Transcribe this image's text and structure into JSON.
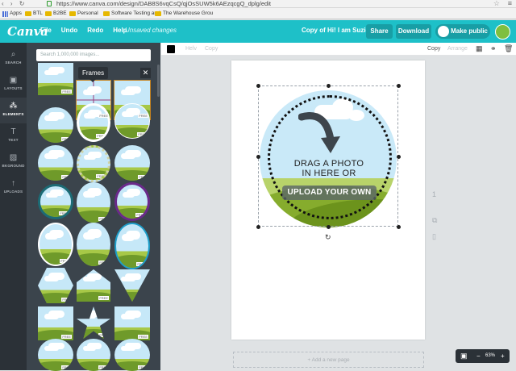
{
  "browser": {
    "url": "https://www.canva.com/design/DAB8S6vqCsQ/qjOsSUW5k6AEzqcgQ_dplg/edit",
    "bookmarks": [
      "Apps",
      "BTL",
      "B2BE",
      "Personal",
      "Software Testing and",
      "The Warehouse Grou"
    ]
  },
  "header": {
    "logo": "Canva",
    "menu": [
      "File",
      "Undo",
      "Redo",
      "Help"
    ],
    "status": "Unsaved changes",
    "doc_title": "Copy of Hi! I am Suzie!",
    "share": "Share",
    "download": "Download",
    "make_public": "Make public"
  },
  "rail": [
    {
      "label": "SEARCH",
      "icon": "search-icon"
    },
    {
      "label": "LAYOUTS",
      "icon": "layouts-icon"
    },
    {
      "label": "ELEMENTS",
      "icon": "elements-icon",
      "active": true
    },
    {
      "label": "TEXT",
      "icon": "text-icon"
    },
    {
      "label": "BKGROUND",
      "icon": "background-icon"
    },
    {
      "label": "UPLOADS",
      "icon": "upload-icon"
    }
  ],
  "panel": {
    "search_placeholder": "Search 1,000,000 images...",
    "tooltip": "Frames",
    "close": "✕",
    "free_badge": "FREE"
  },
  "toolbar": {
    "copy": "Copy",
    "arrange": "Arrange",
    "font_a": "Helv",
    "font_b": "Copy"
  },
  "canvas": {
    "drag_line1": "DRAG A PHOTO",
    "drag_line2": "IN HERE OR",
    "upload": "UPLOAD YOUR OWN",
    "page_number": "1",
    "add_page": "+ Add a new page"
  },
  "zoom": {
    "level": "63%",
    "minus": "−",
    "plus": "+"
  },
  "colors": {
    "brand": "#1ec0c8",
    "panel": "#3b444c",
    "rail": "#2b3137"
  }
}
